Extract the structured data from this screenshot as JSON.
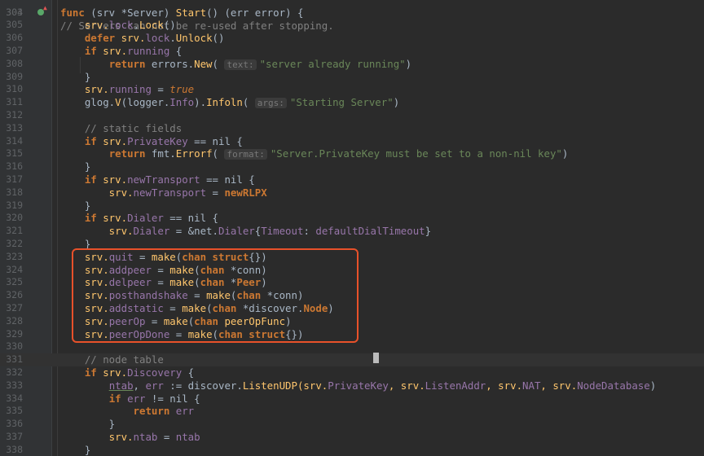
{
  "editor": {
    "top_partial_line": {
      "number": "303",
      "text": "// Servers can not be re-used after stopping."
    },
    "lines": [
      {
        "number": "304",
        "tokens": [
          {
            "t": "func",
            "c": "kw"
          },
          {
            "t": " (srv *",
            "c": "plain"
          },
          {
            "t": "Server",
            "c": "plain"
          },
          {
            "t": ") ",
            "c": "plain"
          },
          {
            "t": "Start",
            "c": "fn"
          },
          {
            "t": "() (err ",
            "c": "plain"
          },
          {
            "t": "error",
            "c": "plain"
          },
          {
            "t": ") {",
            "c": "plain"
          }
        ]
      },
      {
        "number": "305",
        "tokens": [
          {
            "t": "    srv.",
            "c": "recv"
          },
          {
            "t": "lock",
            "c": "fld"
          },
          {
            "t": ".",
            "c": "plain"
          },
          {
            "t": "Lock",
            "c": "fn"
          },
          {
            "t": "()",
            "c": "plain"
          }
        ]
      },
      {
        "number": "306",
        "tokens": [
          {
            "t": "    ",
            "c": "plain"
          },
          {
            "t": "defer",
            "c": "kw"
          },
          {
            "t": " srv.",
            "c": "recv"
          },
          {
            "t": "lock",
            "c": "fld"
          },
          {
            "t": ".",
            "c": "plain"
          },
          {
            "t": "Unlock",
            "c": "fn"
          },
          {
            "t": "()",
            "c": "plain"
          }
        ]
      },
      {
        "number": "307",
        "tokens": [
          {
            "t": "    ",
            "c": "plain"
          },
          {
            "t": "if",
            "c": "kw"
          },
          {
            "t": " srv.",
            "c": "recv"
          },
          {
            "t": "running",
            "c": "fld"
          },
          {
            "t": " {",
            "c": "plain"
          }
        ]
      },
      {
        "number": "308",
        "tokens": [
          {
            "t": "        ",
            "c": "plain"
          },
          {
            "t": "return",
            "c": "kw"
          },
          {
            "t": " errors.",
            "c": "plain"
          },
          {
            "t": "New",
            "c": "fn"
          },
          {
            "t": "( ",
            "c": "plain"
          },
          {
            "t": "text:",
            "c": "hint"
          },
          {
            "t": "\"server already running\"",
            "c": "str"
          },
          {
            "t": ")",
            "c": "plain"
          }
        ]
      },
      {
        "number": "309",
        "tokens": [
          {
            "t": "    }",
            "c": "plain"
          }
        ]
      },
      {
        "number": "310",
        "tokens": [
          {
            "t": "    srv.",
            "c": "recv"
          },
          {
            "t": "running",
            "c": "fld"
          },
          {
            "t": " = ",
            "c": "plain"
          },
          {
            "t": "true",
            "c": "lit"
          }
        ]
      },
      {
        "number": "311",
        "tokens": [
          {
            "t": "    glog.",
            "c": "plain"
          },
          {
            "t": "V",
            "c": "fn"
          },
          {
            "t": "(logger.",
            "c": "plain"
          },
          {
            "t": "Info",
            "c": "fld"
          },
          {
            "t": ").",
            "c": "plain"
          },
          {
            "t": "Infoln",
            "c": "fn"
          },
          {
            "t": "( ",
            "c": "plain"
          },
          {
            "t": "args:",
            "c": "hint"
          },
          {
            "t": "\"Starting Server\"",
            "c": "str"
          },
          {
            "t": ")",
            "c": "plain"
          }
        ]
      },
      {
        "number": "312",
        "tokens": []
      },
      {
        "number": "313",
        "tokens": [
          {
            "t": "    // static fields",
            "c": "cm"
          }
        ]
      },
      {
        "number": "314",
        "tokens": [
          {
            "t": "    ",
            "c": "plain"
          },
          {
            "t": "if",
            "c": "kw"
          },
          {
            "t": " srv.",
            "c": "recv"
          },
          {
            "t": "PrivateKey",
            "c": "fld"
          },
          {
            "t": " == nil {",
            "c": "plain"
          }
        ]
      },
      {
        "number": "315",
        "tokens": [
          {
            "t": "        ",
            "c": "plain"
          },
          {
            "t": "return",
            "c": "kw"
          },
          {
            "t": " fmt.",
            "c": "plain"
          },
          {
            "t": "Errorf",
            "c": "fn"
          },
          {
            "t": "( ",
            "c": "plain"
          },
          {
            "t": "format:",
            "c": "hint"
          },
          {
            "t": "\"Server.PrivateKey must be set to a non-nil key\"",
            "c": "str"
          },
          {
            "t": ")",
            "c": "plain"
          }
        ]
      },
      {
        "number": "316",
        "tokens": [
          {
            "t": "    }",
            "c": "plain"
          }
        ]
      },
      {
        "number": "317",
        "tokens": [
          {
            "t": "    ",
            "c": "plain"
          },
          {
            "t": "if",
            "c": "kw"
          },
          {
            "t": " srv.",
            "c": "recv"
          },
          {
            "t": "newTransport",
            "c": "fld"
          },
          {
            "t": " == nil {",
            "c": "plain"
          }
        ]
      },
      {
        "number": "318",
        "tokens": [
          {
            "t": "        srv.",
            "c": "recv"
          },
          {
            "t": "newTransport",
            "c": "fld"
          },
          {
            "t": " = ",
            "c": "plain"
          },
          {
            "t": "newRLPX",
            "c": "kw"
          }
        ]
      },
      {
        "number": "319",
        "tokens": [
          {
            "t": "    }",
            "c": "plain"
          }
        ]
      },
      {
        "number": "320",
        "tokens": [
          {
            "t": "    ",
            "c": "plain"
          },
          {
            "t": "if",
            "c": "kw"
          },
          {
            "t": " srv.",
            "c": "recv"
          },
          {
            "t": "Dialer",
            "c": "fld"
          },
          {
            "t": " == nil {",
            "c": "plain"
          }
        ]
      },
      {
        "number": "321",
        "tokens": [
          {
            "t": "        srv.",
            "c": "recv"
          },
          {
            "t": "Dialer",
            "c": "fld"
          },
          {
            "t": " = &net.",
            "c": "plain"
          },
          {
            "t": "Dialer",
            "c": "fld"
          },
          {
            "t": "{",
            "c": "plain"
          },
          {
            "t": "Timeout",
            "c": "fld"
          },
          {
            "t": ": ",
            "c": "plain"
          },
          {
            "t": "defaultDialTimeout",
            "c": "fld"
          },
          {
            "t": "}",
            "c": "plain"
          }
        ]
      },
      {
        "number": "322",
        "tokens": [
          {
            "t": "    }",
            "c": "plain"
          }
        ]
      },
      {
        "number": "323",
        "tokens": [
          {
            "t": "    srv.",
            "c": "recv"
          },
          {
            "t": "quit",
            "c": "fld"
          },
          {
            "t": " = ",
            "c": "plain"
          },
          {
            "t": "make",
            "c": "fn"
          },
          {
            "t": "(",
            "c": "plain"
          },
          {
            "t": "chan struct",
            "c": "kw"
          },
          {
            "t": "{})",
            "c": "plain"
          }
        ]
      },
      {
        "number": "324",
        "tokens": [
          {
            "t": "    srv.",
            "c": "recv"
          },
          {
            "t": "addpeer",
            "c": "fld"
          },
          {
            "t": " = ",
            "c": "plain"
          },
          {
            "t": "make",
            "c": "fn"
          },
          {
            "t": "(",
            "c": "plain"
          },
          {
            "t": "chan",
            "c": "kw"
          },
          {
            "t": " *conn)",
            "c": "plain"
          }
        ]
      },
      {
        "number": "325",
        "tokens": [
          {
            "t": "    srv.",
            "c": "recv"
          },
          {
            "t": "delpeer",
            "c": "fld"
          },
          {
            "t": " = ",
            "c": "plain"
          },
          {
            "t": "make",
            "c": "fn"
          },
          {
            "t": "(",
            "c": "plain"
          },
          {
            "t": "chan",
            "c": "kw"
          },
          {
            "t": " *",
            "c": "plain"
          },
          {
            "t": "Peer",
            "c": "kw"
          },
          {
            "t": ")",
            "c": "plain"
          }
        ]
      },
      {
        "number": "326",
        "tokens": [
          {
            "t": "    srv.",
            "c": "recv"
          },
          {
            "t": "posthandshake",
            "c": "fld"
          },
          {
            "t": " = ",
            "c": "plain"
          },
          {
            "t": "make",
            "c": "fn"
          },
          {
            "t": "(",
            "c": "plain"
          },
          {
            "t": "chan",
            "c": "kw"
          },
          {
            "t": " *conn)",
            "c": "plain"
          }
        ]
      },
      {
        "number": "327",
        "tokens": [
          {
            "t": "    srv.",
            "c": "recv"
          },
          {
            "t": "addstatic",
            "c": "fld"
          },
          {
            "t": " = ",
            "c": "plain"
          },
          {
            "t": "make",
            "c": "fn"
          },
          {
            "t": "(",
            "c": "plain"
          },
          {
            "t": "chan",
            "c": "kw"
          },
          {
            "t": " *discover.",
            "c": "plain"
          },
          {
            "t": "Node",
            "c": "kw"
          },
          {
            "t": ")",
            "c": "plain"
          }
        ]
      },
      {
        "number": "328",
        "tokens": [
          {
            "t": "    srv.",
            "c": "recv"
          },
          {
            "t": "peerOp",
            "c": "fld"
          },
          {
            "t": " = ",
            "c": "plain"
          },
          {
            "t": "make",
            "c": "fn"
          },
          {
            "t": "(",
            "c": "plain"
          },
          {
            "t": "chan",
            "c": "kw"
          },
          {
            "t": " ",
            "c": "plain"
          },
          {
            "t": "peerOpFunc",
            "c": "fn"
          },
          {
            "t": ")",
            "c": "plain"
          }
        ]
      },
      {
        "number": "329",
        "tokens": [
          {
            "t": "    srv.",
            "c": "recv"
          },
          {
            "t": "peerOpDone",
            "c": "fld"
          },
          {
            "t": " = ",
            "c": "plain"
          },
          {
            "t": "make",
            "c": "fn"
          },
          {
            "t": "(",
            "c": "plain"
          },
          {
            "t": "chan struct",
            "c": "kw"
          },
          {
            "t": "{})",
            "c": "plain"
          }
        ]
      },
      {
        "number": "330",
        "tokens": []
      },
      {
        "number": "331",
        "tokens": [
          {
            "t": "    // node table",
            "c": "cm"
          }
        ],
        "current": true
      },
      {
        "number": "332",
        "tokens": [
          {
            "t": "    ",
            "c": "plain"
          },
          {
            "t": "if",
            "c": "kw"
          },
          {
            "t": " srv.",
            "c": "recv"
          },
          {
            "t": "Discovery",
            "c": "fld"
          },
          {
            "t": " {",
            "c": "plain"
          }
        ]
      },
      {
        "number": "333",
        "tokens": [
          {
            "t": "        ",
            "c": "plain"
          },
          {
            "t": "ntab",
            "c": "fld underline"
          },
          {
            "t": ", ",
            "c": "plain"
          },
          {
            "t": "err",
            "c": "fld"
          },
          {
            "t": " := discover.",
            "c": "plain"
          },
          {
            "t": "ListenUDP",
            "c": "fn"
          },
          {
            "t": "(srv.",
            "c": "recv"
          },
          {
            "t": "PrivateKey",
            "c": "fld"
          },
          {
            "t": ", srv.",
            "c": "recv"
          },
          {
            "t": "ListenAddr",
            "c": "fld"
          },
          {
            "t": ", srv.",
            "c": "recv"
          },
          {
            "t": "NAT",
            "c": "fld"
          },
          {
            "t": ", srv.",
            "c": "recv"
          },
          {
            "t": "NodeDatabase",
            "c": "fld"
          },
          {
            "t": ")",
            "c": "plain"
          }
        ]
      },
      {
        "number": "334",
        "tokens": [
          {
            "t": "        ",
            "c": "plain"
          },
          {
            "t": "if",
            "c": "kw"
          },
          {
            "t": " ",
            "c": "plain"
          },
          {
            "t": "err",
            "c": "fld"
          },
          {
            "t": " != nil {",
            "c": "plain"
          }
        ]
      },
      {
        "number": "335",
        "tokens": [
          {
            "t": "            ",
            "c": "plain"
          },
          {
            "t": "return",
            "c": "kw"
          },
          {
            "t": " ",
            "c": "plain"
          },
          {
            "t": "err",
            "c": "fld"
          }
        ]
      },
      {
        "number": "336",
        "tokens": [
          {
            "t": "        }",
            "c": "plain"
          }
        ]
      },
      {
        "number": "337",
        "tokens": [
          {
            "t": "        srv.",
            "c": "recv"
          },
          {
            "t": "ntab",
            "c": "fld"
          },
          {
            "t": " = ",
            "c": "plain"
          },
          {
            "t": "ntab",
            "c": "fld"
          }
        ]
      },
      {
        "number": "338",
        "tokens": [
          {
            "t": "    }",
            "c": "plain"
          }
        ]
      }
    ]
  },
  "colors": {
    "background": "#2b2b2b",
    "gutter": "#313335",
    "highlight_border": "#e8512a",
    "keyword": "#cc7832",
    "function": "#ffc66d",
    "field": "#9876aa",
    "string": "#6a8759",
    "comment": "#808080"
  }
}
